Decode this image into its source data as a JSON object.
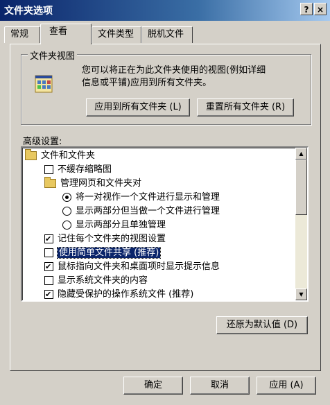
{
  "window": {
    "title": "文件夹选项",
    "help_btn": "?",
    "close_btn": "×"
  },
  "tabs": [
    {
      "label": "常规"
    },
    {
      "label": "查看"
    },
    {
      "label": "文件类型"
    },
    {
      "label": "脱机文件"
    }
  ],
  "folder_view": {
    "legend": "文件夹视图",
    "desc_line1": "您可以将正在为此文件夹使用的视图(例如详细",
    "desc_line2": "信息或平铺)应用到所有文件夹。",
    "apply_all": "应用到所有文件夹 (L)",
    "reset_all": "重置所有文件夹 (R)"
  },
  "advanced": {
    "label": "高级设置:",
    "items": [
      {
        "kind": "folder",
        "text": "文件和文件夹"
      },
      {
        "kind": "check",
        "checked": false,
        "text": "不缓存缩略图"
      },
      {
        "kind": "folder",
        "text": "管理网页和文件夹对"
      },
      {
        "kind": "radio",
        "checked": true,
        "text": "将一对视作一个文件进行显示和管理"
      },
      {
        "kind": "radio",
        "checked": false,
        "text": "显示两部分但当做一个文件进行管理"
      },
      {
        "kind": "radio",
        "checked": false,
        "text": "显示两部分且单独管理"
      },
      {
        "kind": "check",
        "checked": true,
        "text": "记住每个文件夹的视图设置"
      },
      {
        "kind": "check",
        "checked": false,
        "text": "使用简单文件共享 (推荐)",
        "selected": true
      },
      {
        "kind": "check",
        "checked": true,
        "text": "鼠标指向文件夹和桌面项时显示提示信息"
      },
      {
        "kind": "check",
        "checked": false,
        "text": "显示系统文件夹的内容"
      },
      {
        "kind": "check",
        "checked": true,
        "text": "隐藏受保护的操作系统文件 (推荐)"
      }
    ],
    "restore_defaults": "还原为默认值 (D)"
  },
  "footer": {
    "ok": "确定",
    "cancel": "取消",
    "apply": "应用 (A)"
  },
  "colors": {
    "title_start": "#0a246a",
    "title_end": "#a6caf0",
    "face": "#d4d0c8",
    "selection": "#0a246a"
  }
}
